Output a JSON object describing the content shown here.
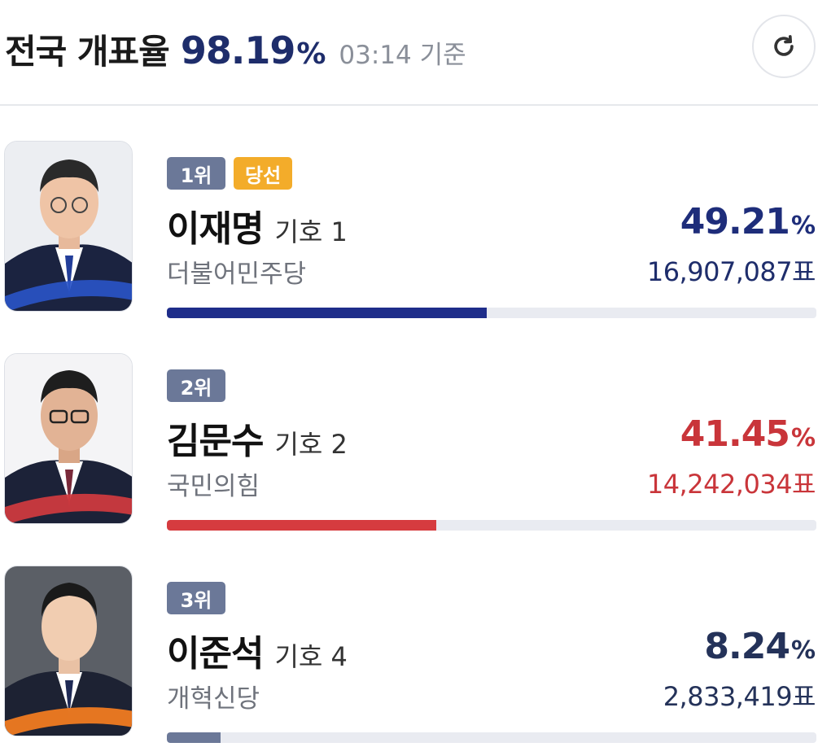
{
  "header": {
    "label": "전국 개표율",
    "rate": "98.19",
    "pct_sign": "%",
    "time": "03:14 기준",
    "refresh_icon": "refresh-icon"
  },
  "candidates": [
    {
      "rank": "1위",
      "winner": "당선",
      "name": "이재명",
      "number": "기호 1",
      "party": "더불어민주당",
      "percent": "49.21",
      "pct_sign": "%",
      "votes": "16,907,087표",
      "bar_fraction": 0.4921,
      "color": "#1e2d7a",
      "votes_color": "#1e2d6b",
      "bar_color": "#1e2d8a",
      "swoosh_color": "#2a54c8",
      "photo_icon": "candidate-photo"
    },
    {
      "rank": "2위",
      "winner": "",
      "name": "김문수",
      "number": "기호 2",
      "party": "국민의힘",
      "percent": "41.45",
      "pct_sign": "%",
      "votes": "14,242,034표",
      "bar_fraction": 0.4145,
      "color": "#c9353a",
      "votes_color": "#c9353a",
      "bar_color": "#d63b3f",
      "swoosh_color": "#d63b3f",
      "photo_icon": "candidate-photo"
    },
    {
      "rank": "3위",
      "winner": "",
      "name": "이준석",
      "number": "기호 4",
      "party": "개혁신당",
      "percent": "8.24",
      "pct_sign": "%",
      "votes": "2,833,419표",
      "bar_fraction": 0.0824,
      "color": "#243259",
      "votes_color": "#243259",
      "bar_color": "#6b7898",
      "swoosh_color": "#f07b21",
      "photo_icon": "candidate-photo"
    }
  ]
}
